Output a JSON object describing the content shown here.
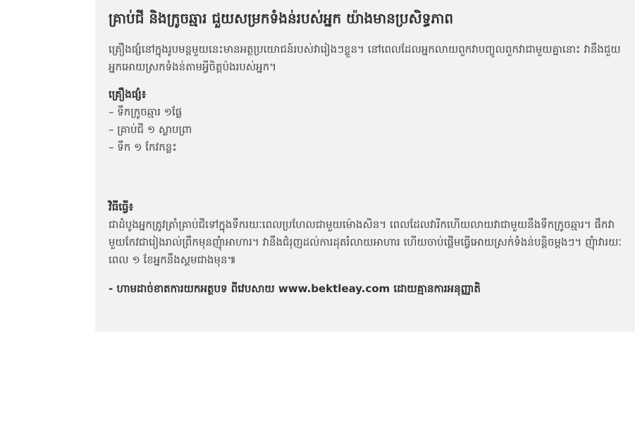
{
  "article": {
    "title": "គ្រាប់ជី និងក្រូចឆ្មារ ជួយសម្រកទំងន់របស់អ្នក យ៉ាងមានប្រសិទ្ធភាព",
    "intro": "គ្រឿងផ្សំនៅក្នុងរូបមន្តមួយនេះមានអត្ថប្រយោជន៍របស់វារៀងៗខ្លួន។ នៅពេលដែលអ្នកលាយពួកវាបញ្ចូលពួកវាជាមួយគ្នានោះ វានឹងជួយអ្នកអោយស្រកទំងន់តាមអ្វីចិត្តប៉ងរបស់អ្នក។",
    "ingredients_heading": "គ្រឿងផ្សំ៖",
    "ingredients": [
      "– ទឹកក្រូចឆ្មារ ១ផ្លែ",
      "– គ្រាប់ជី ១ ស្លាបព្រា",
      "– ទឹក ១ កែវកន្លះ"
    ],
    "method_heading": "វិធីធ្វើ៖",
    "method": "ជាដំបូងអ្នកត្រូវត្រាំគ្រាប់ជីទៅក្នុងទឹករយៈពេលប្រហែលជាមួយម៉ោងសិន។ ពេលដែលវារីកហើយលាយវាជាមួយនឹងទឹកក្រូចឆ្មារ។ ផឹកវាមួយកែវជារៀងរាល់ព្រឹកមុនញុំាអាហារ។ វានឹងជំរុញដល់ការដុតរំលាយអាហារ ហើយចាប់ផ្តើមធ្វើអោយស្រក់ទំងន់បន្តិចម្តងៗ។ ញុំាវារយៈពេល ១ ខែអ្នកនឹងស្គមជាងមុន៕",
    "credit": "- ហាមដាច់ខាតការយកអត្ថបទ ពីវេបសាយ www.bektleay.com ដោយគ្មានការអនុញ្ញាតិ"
  }
}
